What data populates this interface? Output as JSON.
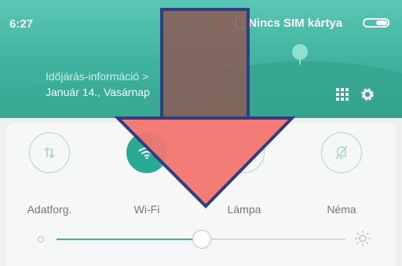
{
  "status_bar": {
    "time": "6:27",
    "sim_text": "Nincs SIM kártya",
    "wifi_color": "#ff7a7a"
  },
  "weather": {
    "info_link": "Időjárás-információ >",
    "date": "Január 14., Vasárnap"
  },
  "toggles": [
    {
      "label": "Adatforg.",
      "icon": "data-transfer-icon",
      "active": false
    },
    {
      "label": "Wi-Fi",
      "icon": "wifi-icon",
      "active": true
    },
    {
      "label": "Lámpa",
      "icon": "flashlight-icon",
      "active": false
    },
    {
      "label": "Néma",
      "icon": "silent-bell-icon",
      "active": false
    }
  ],
  "brightness": {
    "level_fraction": 0.48
  },
  "colors": {
    "accent": "#3fb29f",
    "overlay_arrow": "#f2756f",
    "overlay_shaft": "#8b5a55"
  }
}
